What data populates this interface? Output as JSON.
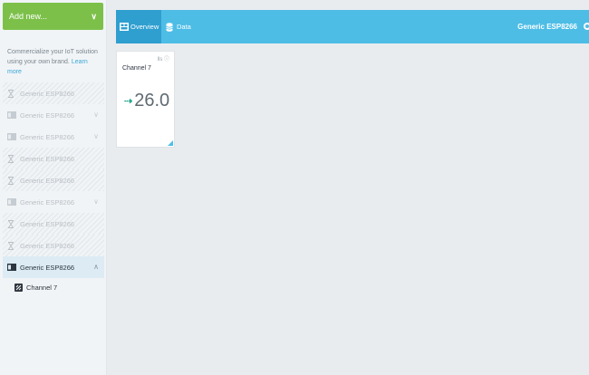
{
  "sidebar": {
    "add_new_label": "Add new...",
    "promo_text": "Commercialize your IoT solution using your own brand.",
    "promo_link": "Learn more",
    "devices": [
      {
        "label": "Generic ESP8266",
        "icon": "hourglass-icon",
        "state": "pending"
      },
      {
        "label": "Generic ESP8266",
        "icon": "chip-icon",
        "state": "collapsed"
      },
      {
        "label": "Generic ESP8266",
        "icon": "chip-icon",
        "state": "collapsed"
      },
      {
        "label": "Generic ESP8266",
        "icon": "hourglass-icon",
        "state": "pending"
      },
      {
        "label": "Generic ESP8266",
        "icon": "hourglass-icon",
        "state": "pending"
      },
      {
        "label": "Generic ESP8266",
        "icon": "chip-icon",
        "state": "collapsed"
      },
      {
        "label": "Generic ESP8266",
        "icon": "hourglass-icon",
        "state": "pending"
      },
      {
        "label": "Generic ESP8266",
        "icon": "hourglass-icon",
        "state": "pending"
      },
      {
        "label": "Generic ESP8266",
        "icon": "chip-icon",
        "state": "expanded"
      }
    ],
    "channel_label": "Channel 7"
  },
  "header": {
    "tabs": [
      {
        "label": "Overview",
        "active": true
      },
      {
        "label": "Data",
        "active": false
      }
    ],
    "device_title": "Generic ESP8266"
  },
  "widget": {
    "title": "Channel 7",
    "value": "26.0",
    "meta": "lls ⓘ"
  },
  "colors": {
    "accent": "#4dbde6",
    "accent_dark": "#2f9fd0",
    "add_button": "#7cc04a",
    "arrow": "#1fa58a"
  }
}
